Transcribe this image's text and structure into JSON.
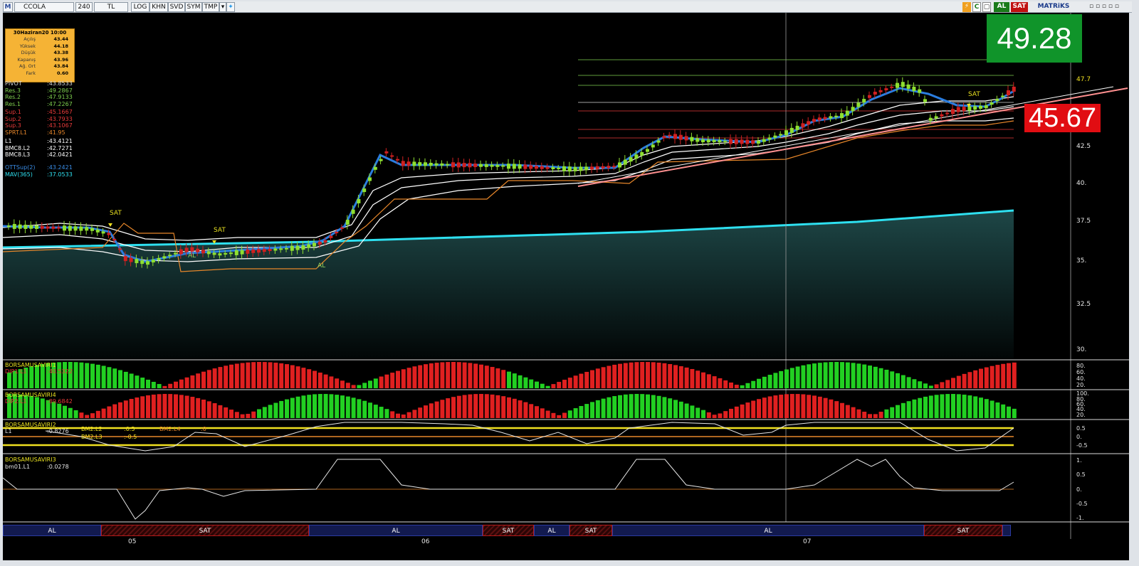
{
  "toolbar": {
    "logo": "M",
    "symbol": "CCOLA",
    "period": "240",
    "currency": "TL",
    "buttons": [
      "LOG",
      "KHN",
      "SVD",
      "SYM",
      "TMP"
    ],
    "al_label": "AL",
    "sat_label": "SAT",
    "brand": "MATRiKS",
    "colors": {
      "al": "#1a7a1a",
      "sat": "#c01010"
    }
  },
  "ohlc": {
    "title": "30Haziran20 10:00",
    "rows": [
      {
        "k": "Açılış",
        "v": "43.44"
      },
      {
        "k": "Yüksek",
        "v": "44.18"
      },
      {
        "k": "Düşük",
        "v": "43.38"
      },
      {
        "k": "Kapanış",
        "v": "43.96"
      },
      {
        "k": "Ağ. Ort",
        "v": "43.84"
      },
      {
        "k": "Fark",
        "v": "0.60"
      }
    ]
  },
  "levels": [
    {
      "name": "PIVOT",
      "value": ":43.8533",
      "color": "#d8d8d8"
    },
    {
      "name": "Res.3",
      "value": ":49.2867",
      "color": "#7fd04f"
    },
    {
      "name": "Res.2",
      "value": ":47.9133",
      "color": "#7fd04f"
    },
    {
      "name": "Res.1",
      "value": ":47.2267",
      "color": "#7fd04f"
    },
    {
      "name": "Sup.1",
      "value": ":45.1667",
      "color": "#e83a3a"
    },
    {
      "name": "Sup.2",
      "value": ":43.7933",
      "color": "#e83a3a"
    },
    {
      "name": "Sup.3",
      "value": ":43.1067",
      "color": "#e83a3a"
    },
    {
      "name": "SPRT.L1",
      "value": ":41.95",
      "color": "#e8872a"
    },
    {
      "name": "L1",
      "value": ":43.4121",
      "color": "#ffffff"
    },
    {
      "name": "BMC8.L2",
      "value": ":42.7271",
      "color": "#ffffff"
    },
    {
      "name": "BMC8.L3",
      "value": ":42.0421",
      "color": "#ffffff"
    },
    {
      "name": "OTTSup(2)",
      "value": ":43.2421",
      "color": "#3a8ee8"
    },
    {
      "name": "MAV(365)",
      "value": ":37.0533",
      "color": "#2ee0f0"
    }
  ],
  "big_price": "49.28",
  "price_tag": "45.67",
  "price_axis": [
    "47.7",
    "42.5",
    "40.",
    "37.5",
    "35.",
    "32.5",
    "30."
  ],
  "chart_annotations": {
    "sat": "SAT",
    "al": "AL"
  },
  "panels": {
    "p1": {
      "title": "BORSAMUSAVIRI1",
      "sub": "DIP1.L1",
      "subval": ":40.5322",
      "axis": [
        "80.",
        "60.",
        "40.",
        "20."
      ]
    },
    "p2": {
      "title": "BORSAMUSAVIRI4",
      "sub": "DIP2.L1",
      "subval": ":89.6842",
      "axis": [
        "100.",
        "80.",
        "60.",
        "40.",
        "20."
      ]
    },
    "p3": {
      "title": "BORSAMUSAVIRI2",
      "l1": "L1",
      "l1val": ":0.8276",
      "bm2l2": "BM2.L2",
      "bm2l2v": ":0.5",
      "bm2l4": "BM2.L4",
      "bm2l4v": ":0",
      "bm2l3": "BM2.L3",
      "bm2l3v": ":-0.5",
      "axis": [
        "0.5",
        "0.",
        "-0.5"
      ]
    },
    "p4": {
      "title": "BORSAMUSAVIRI3",
      "sub": "bm01.L1",
      "subval": ":0.0278",
      "axis": [
        "1.",
        "0.5",
        "0.",
        "-0.5",
        "-1."
      ]
    }
  },
  "signals": [
    {
      "label": "AL",
      "type": "al"
    },
    {
      "label": "SAT",
      "type": "sat"
    },
    {
      "label": "AL",
      "type": "al"
    },
    {
      "label": "SAT",
      "type": "sat"
    },
    {
      "label": "AL",
      "type": "al"
    },
    {
      "label": "SAT",
      "type": "sat"
    },
    {
      "label": "AL",
      "type": "al"
    },
    {
      "label": "SAT",
      "type": "sat"
    }
  ],
  "dates": [
    "05",
    "06",
    "07"
  ]
}
